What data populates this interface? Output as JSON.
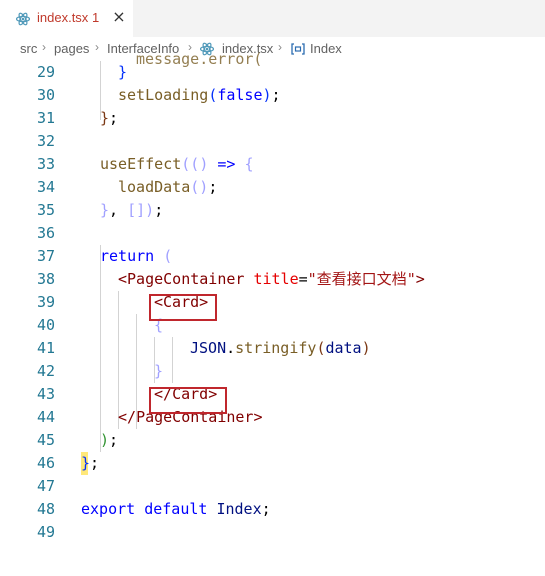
{
  "tab": {
    "filename": "index.tsx",
    "problems": "1",
    "close": "×"
  },
  "breadcrumb": {
    "items": [
      "src",
      "pages",
      "InterfaceInfo",
      "index.tsx",
      "Index"
    ],
    "separator": "›"
  },
  "lines": [
    {
      "n": "29"
    },
    {
      "n": "30"
    },
    {
      "n": "31"
    },
    {
      "n": "32"
    },
    {
      "n": "33"
    },
    {
      "n": "34"
    },
    {
      "n": "35"
    },
    {
      "n": "36"
    },
    {
      "n": "37"
    },
    {
      "n": "38"
    },
    {
      "n": "39"
    },
    {
      "n": "40"
    },
    {
      "n": "41"
    },
    {
      "n": "42"
    },
    {
      "n": "43"
    },
    {
      "n": "44"
    },
    {
      "n": "45"
    },
    {
      "n": "46"
    },
    {
      "n": "47"
    },
    {
      "n": "48"
    },
    {
      "n": "49"
    }
  ],
  "code": {
    "l30_fn": "setLoading",
    "l30_kw": "false",
    "l33_fn": "useEffect",
    "l33_arrow": "=>",
    "l34_fn": "loadData",
    "l37_kw": "return",
    "l38_tag": "PageContainer",
    "l38_attr": "title",
    "l38_val": "\"查看接口文档\"",
    "l39_tag": "Card",
    "l41_obj": "JSON",
    "l41_fn": "stringify",
    "l41_arg": "data",
    "l43_tag": "Card",
    "l44_tag": "PageContainer",
    "l48_kw1": "export",
    "l48_kw2": "default",
    "l48_id": "Index"
  },
  "colors": {
    "highlight_box": "#c0272d",
    "line_number": "#237893",
    "tab_error": "#c0392b"
  }
}
